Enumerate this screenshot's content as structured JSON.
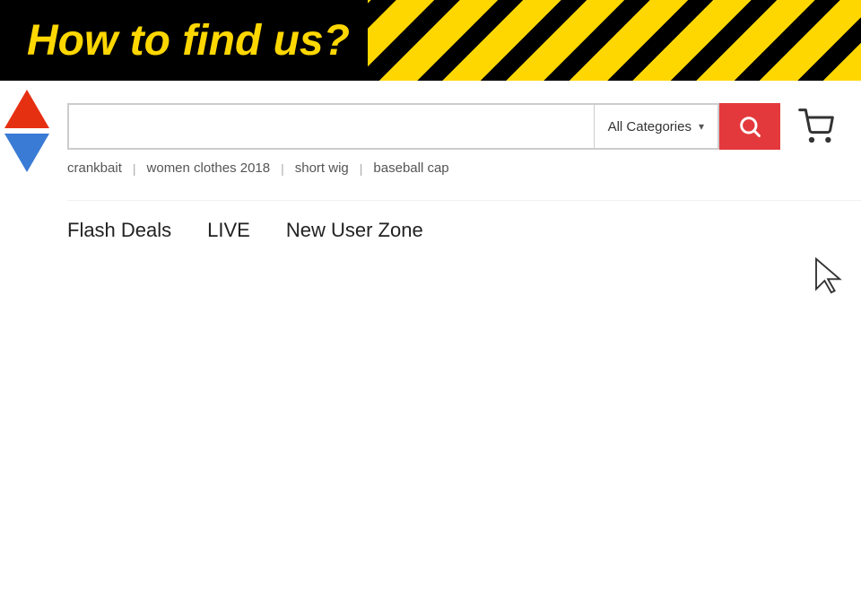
{
  "banner": {
    "title": "How to find us?",
    "stripes": "diagonal yellow-black pattern"
  },
  "search": {
    "input_placeholder": "",
    "category_label": "All Categories",
    "button_aria": "Search"
  },
  "suggestions": {
    "items": [
      {
        "label": "crankbait"
      },
      {
        "label": "women clothes 2018"
      },
      {
        "label": "short wig"
      },
      {
        "label": "baseball cap"
      }
    ]
  },
  "nav": {
    "tabs": [
      {
        "label": "Flash Deals"
      },
      {
        "label": "LIVE"
      },
      {
        "label": "New User Zone"
      }
    ]
  }
}
